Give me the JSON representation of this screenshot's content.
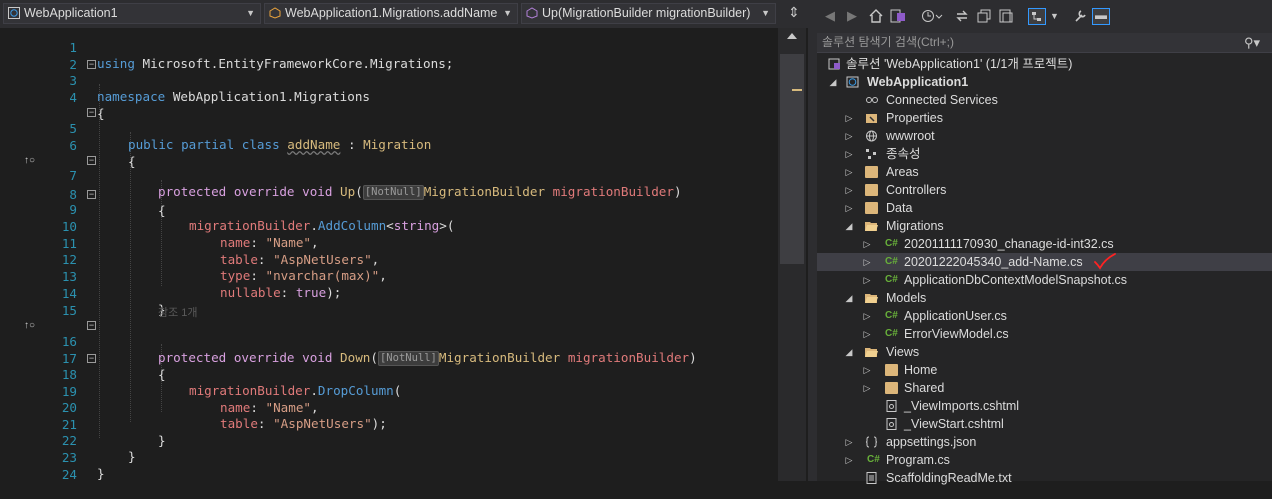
{
  "nav": {
    "project_dropdown": "WebApplication1",
    "class_dropdown": "WebApplication1.Migrations.addName",
    "member_dropdown": "Up(MigrationBuilder migrationBuilder)"
  },
  "code": {
    "line_numbers": [
      "1",
      "2",
      "3",
      "4",
      "5",
      "6",
      "7",
      "8",
      "9",
      "10",
      "11",
      "12",
      "13",
      "14",
      "15",
      "16",
      "17",
      "18",
      "19",
      "20",
      "21",
      "22",
      "23",
      "24"
    ],
    "l1_using": "using",
    "l1_ns": "Microsoft.EntityFrameworkCore.Migrations;",
    "l3_namespace": "namespace",
    "l3_name": "WebApplication1.Migrations",
    "brace_open": "{",
    "brace_close": "}",
    "l5_public": "public",
    "l5_partial": "partial",
    "l5_class": "class",
    "l5_name": "addName",
    "l5_colon": " : ",
    "l5_base": "Migration",
    "protected": "protected",
    "override": "override",
    "void": "void",
    "l7_up": "Up",
    "paren_open": "(",
    "hint": "[NotNull]",
    "param_type": "MigrationBuilder",
    "param_name": "migrationBuilder",
    "paren_close": ")",
    "l9_builder": "migrationBuilder",
    "dot": ".",
    "l9_method": "AddColumn",
    "l9_generic_open": "<",
    "l9_string": "string",
    "l9_generic_close": ">(",
    "name_label": "name",
    "table_label": "table",
    "type_label": "type",
    "nullable_label": "nullable",
    "colon": ": ",
    "name_value": "\"Name\"",
    "table_value": "\"AspNetUsers\"",
    "type_value": "\"nvarchar(max)\"",
    "true_value": "true",
    "comma": ",",
    "end_call": ");",
    "references": "참조 1개",
    "l16_down": "Down",
    "l18_method": "DropColumn",
    "open_paren_only": "("
  },
  "solution_explorer": {
    "search_placeholder": "솔루션 탐색기 검색(Ctrl+;)",
    "solution_label": "솔루션 'WebApplication1' (1/1개 프로젝트)",
    "project": "WebApplication1",
    "items": {
      "connected": "Connected Services",
      "properties": "Properties",
      "wwwroot": "wwwroot",
      "deps": "종속성",
      "areas": "Areas",
      "controllers": "Controllers",
      "data": "Data",
      "migrations": "Migrations",
      "mig1": "20201111170930_chanage-id-int32.cs",
      "mig2": "20201222045340_add-Name.cs",
      "mig3": "ApplicationDbContextModelSnapshot.cs",
      "models": "Models",
      "appuser": "ApplicationUser.cs",
      "errorvm": "ErrorViewModel.cs",
      "views": "Views",
      "home": "Home",
      "shared": "Shared",
      "viewimports": "_ViewImports.cshtml",
      "viewstart": "_ViewStart.cshtml",
      "appsettings": "appsettings.json",
      "program": "Program.cs",
      "scaffold": "ScaffoldingReadMe.txt"
    },
    "cs_badge": "C#"
  },
  "colors": {
    "keyword": "#569cd6",
    "class": "#4ec9b0",
    "string": "#d69d85",
    "folder": "#dcb67a",
    "annotation": "#ff2222"
  }
}
